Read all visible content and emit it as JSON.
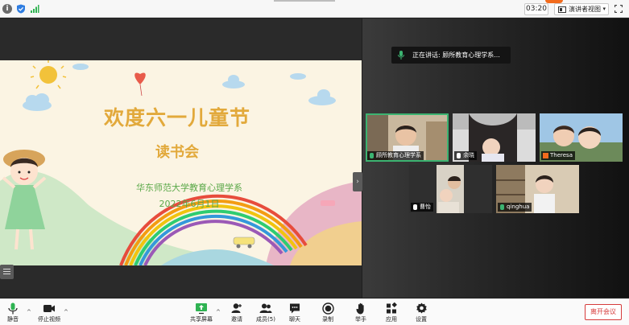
{
  "topbar": {
    "timer": "03:20",
    "view_label": "演讲者视图",
    "view_caret": "▾"
  },
  "slide": {
    "title": "欢度六一儿童节",
    "subtitle": "读书会",
    "organization": "华东师范大学教育心理学系",
    "date": "2022年6月1日"
  },
  "gallery": {
    "speaking_label": "正在讲话: 顾所教育心理学系...",
    "participants": [
      {
        "name": "顾所教育心理学系"
      },
      {
        "name": "余晓"
      },
      {
        "name": "Theresa"
      },
      {
        "name": "曹怡"
      },
      {
        "name": "qinghua"
      }
    ]
  },
  "toolbar": {
    "mute_label": "静音",
    "stop_video_label": "停止视频",
    "share_label": "共享屏幕",
    "invite_label": "邀请",
    "members_label": "成员(5)",
    "chat_label": "聊天",
    "record_label": "录制",
    "raise_hand_label": "举手",
    "apps_label": "应用",
    "settings_label": "设置",
    "leave_label": "离开会议"
  },
  "colors": {
    "accent_green": "#3cb371",
    "leave_red": "#d63b3b",
    "slide_title": "#e2a93b",
    "slide_text": "#5aa848"
  }
}
